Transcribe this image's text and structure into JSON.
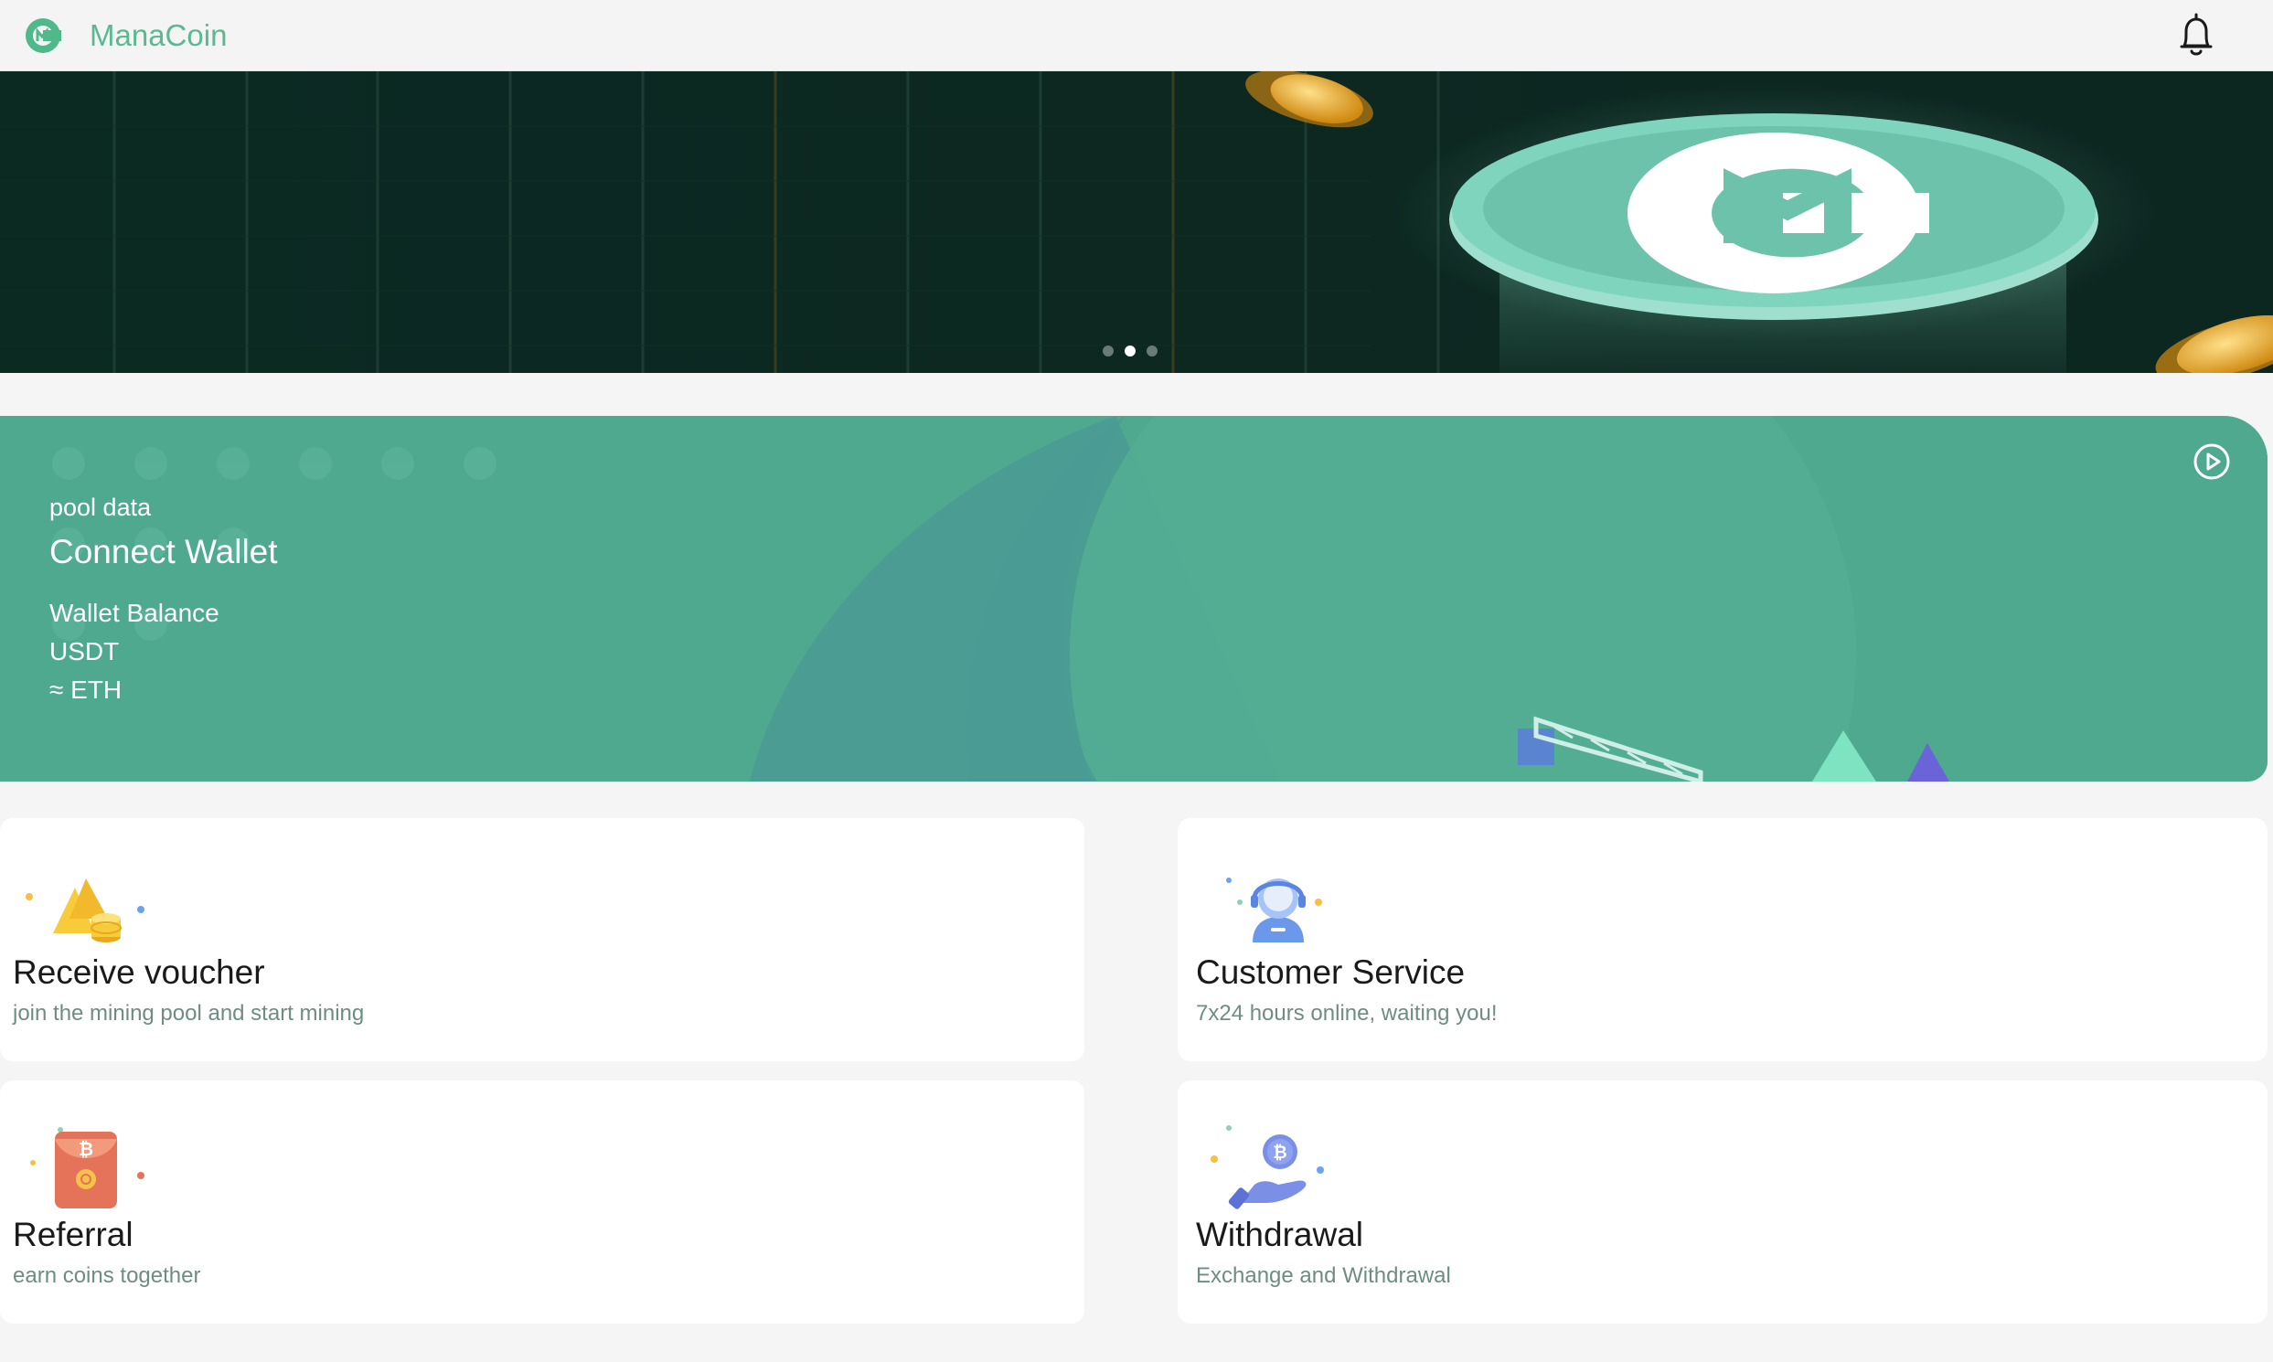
{
  "app": {
    "brand": "ManaCoin",
    "logo_icon": "manacoin-logo-icon",
    "notification_icon": "bell-icon",
    "accent_color": "#5bb991"
  },
  "banner": {
    "slides_count": 3,
    "active_slide": 2,
    "background_color": "#09231c"
  },
  "pool": {
    "label": "pool data",
    "title": "Connect Wallet",
    "wallet_balance_label": "Wallet Balance",
    "usdt_label": "USDT",
    "eth_label": "≈ ETH",
    "play_icon": "play-circle-icon",
    "background_color": "#4fa98e"
  },
  "cards": [
    {
      "title": "Receive voucher",
      "subtitle": "join the mining pool and start mining",
      "icon": "gold-coins-icon"
    },
    {
      "title": "Customer Service",
      "subtitle": "7x24 hours online, waiting you!",
      "icon": "headset-agent-icon"
    },
    {
      "title": "Referral",
      "subtitle": "earn coins together",
      "icon": "red-envelope-bitcoin-icon"
    },
    {
      "title": "Withdrawal",
      "subtitle": "Exchange and Withdrawal",
      "icon": "bitcoin-hand-icon"
    }
  ]
}
